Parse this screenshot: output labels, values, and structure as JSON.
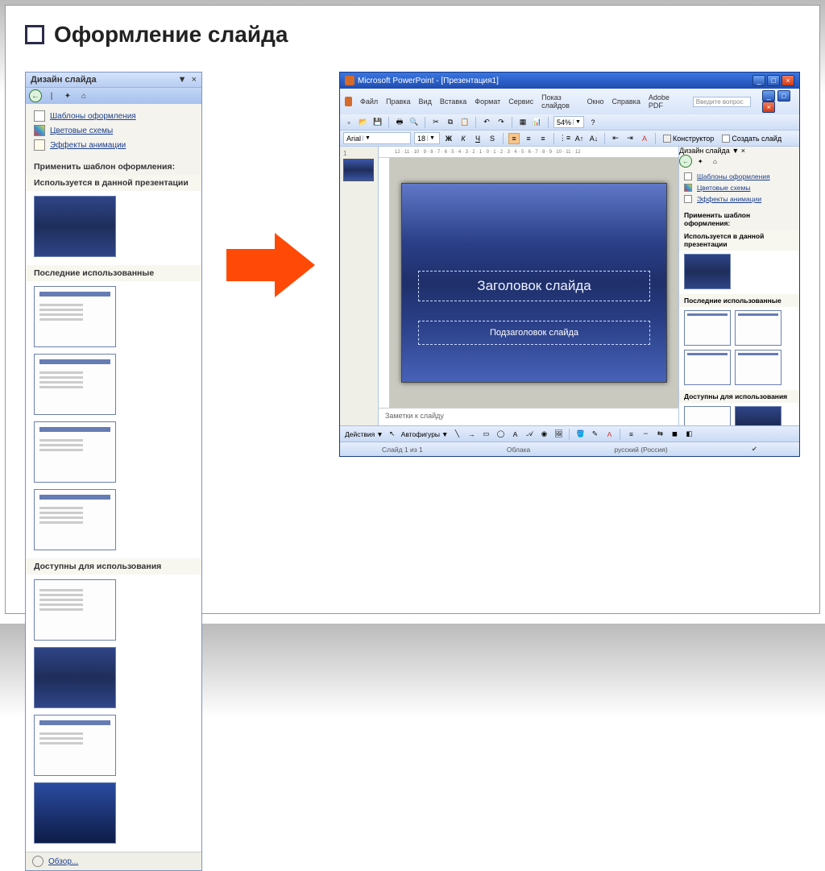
{
  "page": {
    "title": "Оформление слайда"
  },
  "taskpane": {
    "title": "Дизайн слайда",
    "links": {
      "templates": "Шаблоны оформления",
      "colors": "Цветовые схемы",
      "effects": "Эффекты анимации"
    },
    "applyLabel": "Применить шаблон оформления:",
    "groups": {
      "used": "Используется в данной презентации",
      "recent": "Последние использованные",
      "available": "Доступны для использования"
    },
    "browse": "Обзор..."
  },
  "icons": {
    "dropdown": "▼",
    "close": "×",
    "back": "←",
    "star": "✦",
    "home": "⌂"
  },
  "ppwin": {
    "title": "Microsoft PowerPoint - [Презентация1]",
    "menu": {
      "file": "Файл",
      "edit": "Правка",
      "view": "Вид",
      "insert": "Вставка",
      "format": "Формат",
      "tools": "Сервис",
      "slideshow": "Показ слайдов",
      "window": "Окно",
      "help": "Справка",
      "adobe": "Adobe PDF"
    },
    "askPlaceholder": "Введите вопрос",
    "font": "Arial",
    "fontsize": "18",
    "zoom": "54%",
    "constructor": "Конструктор",
    "newslide": "Создать слайд",
    "ruler": "12 · 11 · 10 · 9 · 8 · 7 · 6 · 5 · 4 · 3 · 2 · 1 · 0 · 1 · 2 · 3 · 4 · 5 · 6 · 7 · 8 · 9 · 10 · 11 · 12",
    "slideTitle": "Заголовок слайда",
    "slideSubtitle": "Подзаголовок слайда",
    "notes": "Заметки к слайду",
    "slideIndex": "1",
    "draw": {
      "actions": "Действия",
      "autoshapes": "Автофигуры"
    },
    "status": {
      "slide": "Слайд 1 из 1",
      "theme": "Облака",
      "lang": "русский (Россия)"
    },
    "format_bold": "Ж",
    "format_italic": "К",
    "format_underline": "Ч"
  }
}
